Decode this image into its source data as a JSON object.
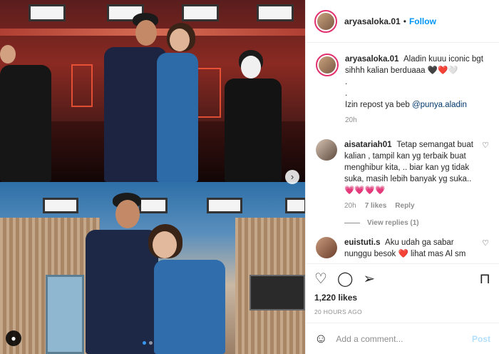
{
  "post": {
    "username": "aryasaloka.01",
    "separator": "•",
    "follow_label": "Follow"
  },
  "caption": {
    "username": "aryasaloka.01",
    "line1": "Aladin kuuu iconic bgt sihhh kalian berduaaa 🖤❤️🤍",
    "dot1": ".",
    "dot2": ".",
    "line2_prefix": "Izin repost ya beb ",
    "mention": "@punya.aladin",
    "time": "20h"
  },
  "comments": [
    {
      "username": "aisatariah01",
      "text": "Tetap semangat buat kalian , tampil kan yg terbaik buat menghibur kita, .. biar kan yg tidak suka, masih lebih banyak yg suka.. 💗💗💗💗",
      "time": "20h",
      "likes": "7 likes",
      "reply": "Reply",
      "view_replies": "View replies (1)"
    },
    {
      "username": "euistuti.s",
      "text": "Aku udah ga sabar nunggu besok ❤️ lihat mas Al sm"
    }
  ],
  "actions": {
    "likes": "1,220 likes",
    "posted": "20 HOURS AGO"
  },
  "add_comment": {
    "placeholder": "Add a comment...",
    "post_label": "Post"
  },
  "icons": {
    "heart": "heart-icon",
    "comment": "comment-icon",
    "share": "share-icon",
    "bookmark": "bookmark-icon",
    "emoji": "emoji-icon",
    "next": "chevron-right-icon",
    "user_tag": "user-tag-icon"
  },
  "colors": {
    "accent": "#0095f6",
    "post_disabled": "#b2dffc",
    "muted": "#8e8e8e"
  }
}
